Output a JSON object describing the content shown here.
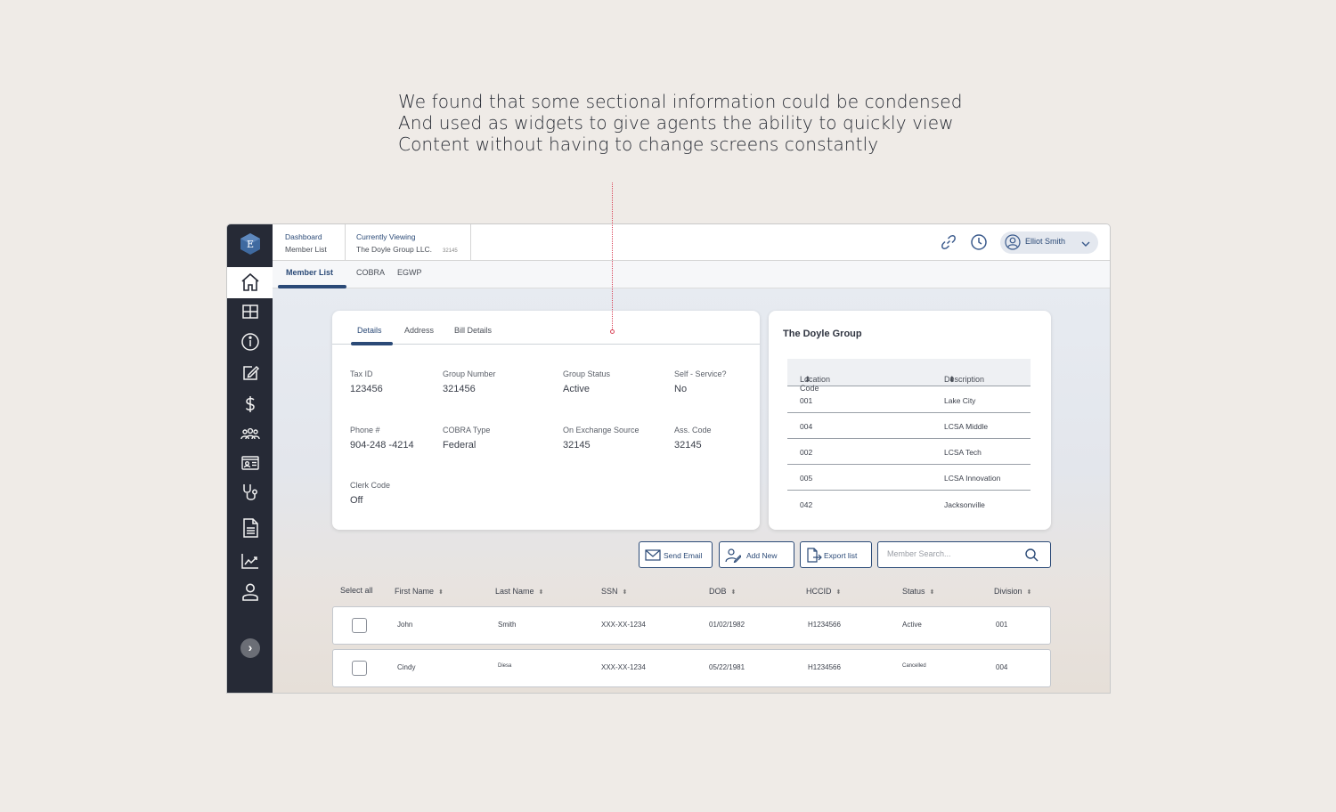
{
  "caption": [
    "We found that some sectional information could be condensed",
    "And used as widgets to give agents the ability to quickly view",
    "Content without having to change screens constantly"
  ],
  "logo_letter": "E",
  "breadcrumb": {
    "section": "Dashboard",
    "page": "Member List",
    "viewing_label": "Currently Viewing",
    "viewing_name": "The Doyle Group LLC.",
    "viewing_id": "32145"
  },
  "user": {
    "name": "Elliot Smith"
  },
  "subtabs": [
    "Member List",
    "COBRA",
    "EGWP"
  ],
  "details": {
    "tabs": [
      "Details",
      "Address",
      "Bill Details"
    ],
    "fields": [
      {
        "label": "Tax ID",
        "value": "123456"
      },
      {
        "label": "Group Number",
        "value": "321456"
      },
      {
        "label": "Group Status",
        "value": "Active"
      },
      {
        "label": "Self - Service?",
        "value": "No"
      },
      {
        "label": "Phone #",
        "value": "904-248 -4214"
      },
      {
        "label": "COBRA Type",
        "value": "Federal"
      },
      {
        "label": "On Exchange Source",
        "value": "32145"
      },
      {
        "label": "Ass. Code",
        "value": "32145"
      },
      {
        "label": "Clerk Code",
        "value": "Off"
      }
    ]
  },
  "group": {
    "title": "The Doyle Group",
    "headers": [
      "Location Code",
      "Description"
    ],
    "rows": [
      {
        "code": "001",
        "desc": "Lake City"
      },
      {
        "code": "004",
        "desc": "LCSA Middle"
      },
      {
        "code": "002",
        "desc": "LCSA Tech"
      },
      {
        "code": "005",
        "desc": "LCSA Innovation"
      },
      {
        "code": "042",
        "desc": "Jacksonville"
      }
    ]
  },
  "actions": {
    "send_email": "Send Email",
    "add_new": "Add New",
    "export_list": "Export list",
    "search_placeholder": "Member Search..."
  },
  "members": {
    "select_all": "Select all",
    "headers": [
      "First Name",
      "Last Name",
      "SSN",
      "DOB",
      "HCCID",
      "Status",
      "Division"
    ],
    "rows": [
      {
        "first": "John",
        "last": "Smith",
        "ssn": "XXX-XX-1234",
        "dob": "01/02/1982",
        "hccid": "H1234566",
        "status": "Active",
        "division": "001"
      },
      {
        "first": "Cindy",
        "last": "Diesa",
        "ssn": "XXX-XX-1234",
        "dob": "05/22/1981",
        "hccid": "H1234566",
        "status": "Cancelled",
        "division": "004"
      }
    ]
  },
  "colors": {
    "accent": "#2b4a77",
    "sidebar": "#262a36",
    "annotation": "#d9465a"
  }
}
